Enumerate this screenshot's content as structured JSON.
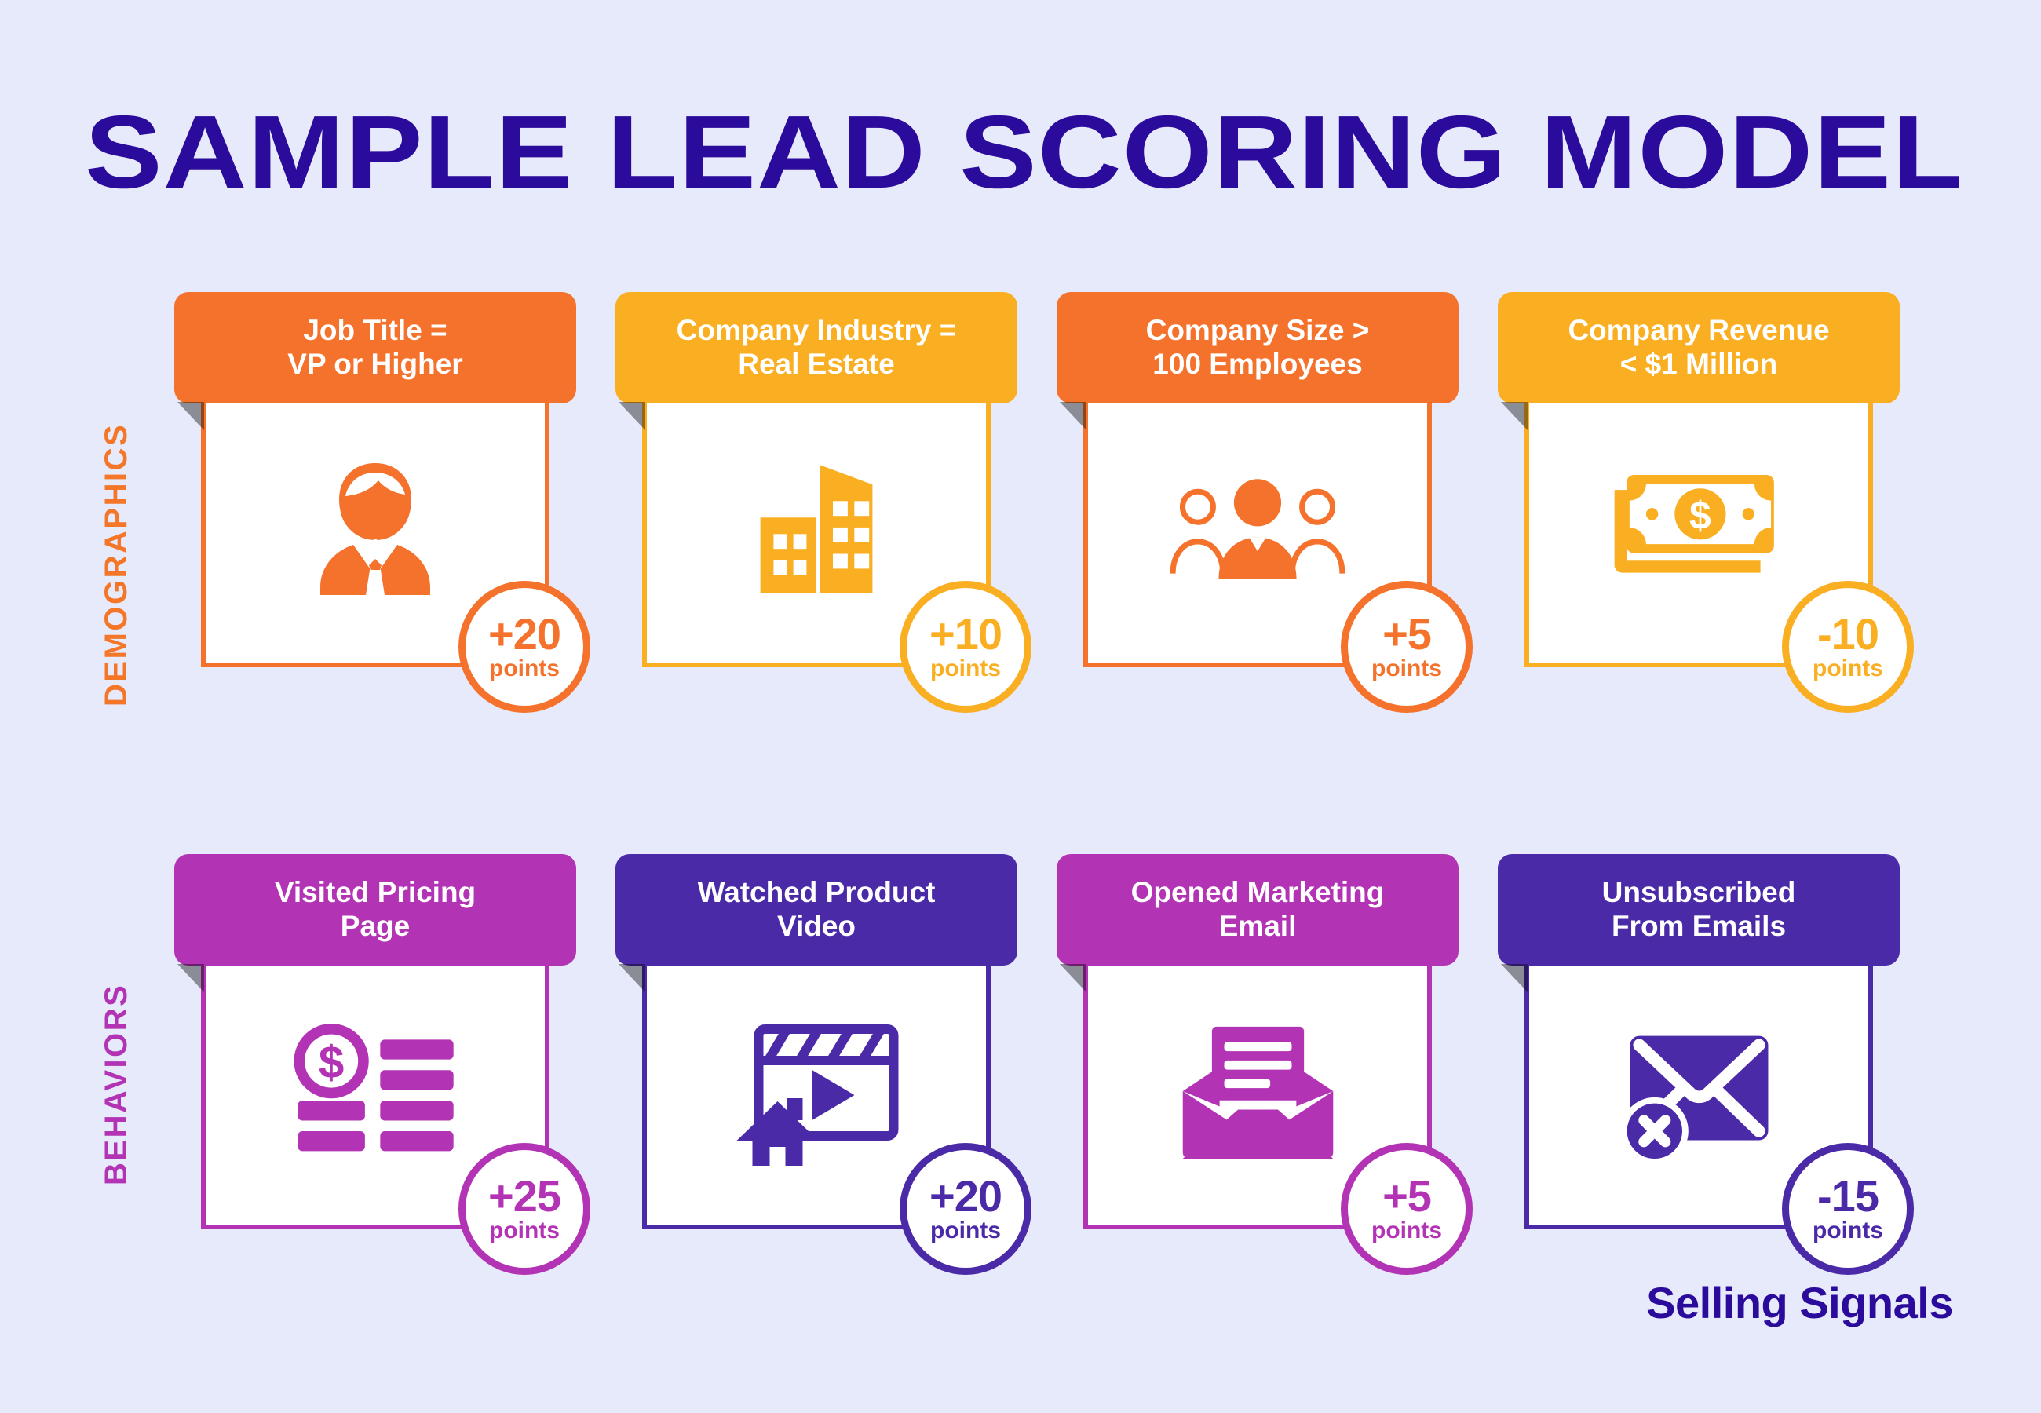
{
  "page": {
    "title": "SAMPLE LEAD SCORING MODEL",
    "background_color": "#E7EAFB",
    "title_color": "#2B0B9B",
    "brand": "Selling Signals"
  },
  "rows": [
    {
      "label": "DEMOGRAPHICS",
      "label_color": "#F47629",
      "cards": [
        {
          "title": "Job Title =\nVP or Higher",
          "color": "#F4722B",
          "points": "+20",
          "points_label": "points",
          "icon": "executive-person-icon"
        },
        {
          "title": "Company Industry =\nReal Estate",
          "color": "#FAAE21",
          "points": "+10",
          "points_label": "points",
          "icon": "office-buildings-icon"
        },
        {
          "title": "Company Size >\n100 Employees",
          "color": "#F4722B",
          "points": "+5",
          "points_label": "points",
          "icon": "group-of-people-icon"
        },
        {
          "title": "Company Revenue\n< $1 Million",
          "color": "#FAAE21",
          "points": "-10",
          "points_label": "points",
          "icon": "dollar-banknote-icon"
        }
      ]
    },
    {
      "label": "BEHAVIORS",
      "label_color": "#B333B5",
      "cards": [
        {
          "title": "Visited Pricing\nPage",
          "color": "#B333B5",
          "points": "+25",
          "points_label": "points",
          "icon": "price-list-icon"
        },
        {
          "title": "Watched Product\nVideo",
          "color": "#4B2AA8",
          "points": "+20",
          "points_label": "points",
          "icon": "video-clapperboard-house-icon"
        },
        {
          "title": "Opened Marketing\nEmail",
          "color": "#B333B5",
          "points": "+5",
          "points_label": "points",
          "icon": "open-envelope-letter-icon"
        },
        {
          "title": "Unsubscribed\nFrom Emails",
          "color": "#4B2AA8",
          "points": "-15",
          "points_label": "points",
          "icon": "envelope-cancel-icon"
        }
      ]
    }
  ]
}
